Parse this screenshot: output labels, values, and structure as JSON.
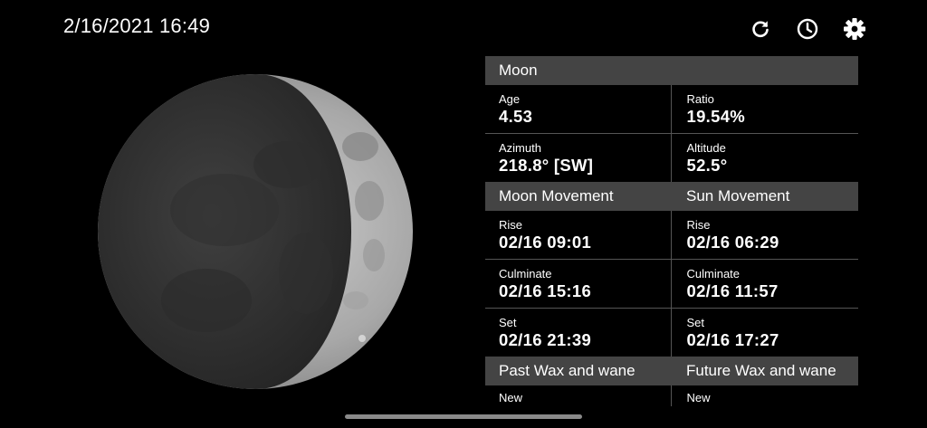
{
  "datetime": "2/16/2021 16:49",
  "toolbar": {
    "icons": [
      "refresh-icon",
      "clock-icon",
      "gear-icon"
    ]
  },
  "moon_panel": {
    "title": "Moon",
    "age_label": "Age",
    "age_value": "4.53",
    "ratio_label": "Ratio",
    "ratio_value": "19.54%",
    "azimuth_label": "Azimuth",
    "azimuth_value": "218.8° [SW]",
    "altitude_label": "Altitude",
    "altitude_value": "52.5°"
  },
  "movement": {
    "moon_title": "Moon Movement",
    "sun_title": "Sun Movement",
    "rows": [
      {
        "label": "Rise",
        "moon": "02/16 09:01",
        "sun": "02/16 06:29"
      },
      {
        "label": "Culminate",
        "moon": "02/16 15:16",
        "sun": "02/16 11:57"
      },
      {
        "label": "Set",
        "moon": "02/16 21:39",
        "sun": "02/16 17:27"
      }
    ]
  },
  "wax_wane": {
    "past_title": "Past Wax and wane",
    "future_title": "Future Wax and wane",
    "past_first": "New",
    "future_first": "New"
  },
  "colors": {
    "header_bg": "#444444",
    "divider": "#555555",
    "background": "#000000"
  }
}
